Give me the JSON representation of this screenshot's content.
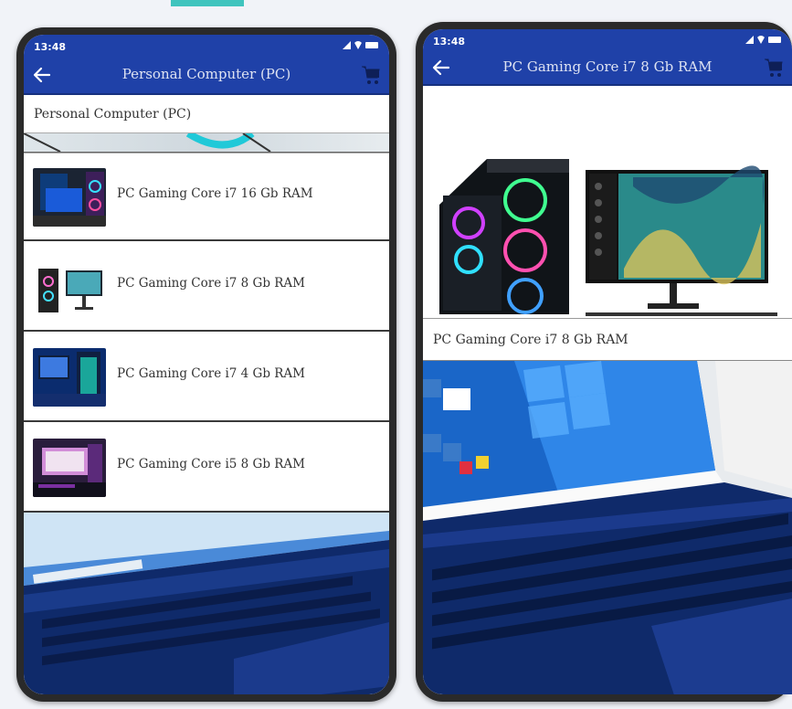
{
  "left_phone": {
    "status_time": "13:48",
    "title": "Personal Computer (PC)",
    "category_label": "Personal Computer (PC)",
    "products": [
      {
        "name": "PC Gaming Core i7 16 Gb RAM"
      },
      {
        "name": "PC Gaming Core i7 8 Gb RAM"
      },
      {
        "name": "PC Gaming Core i7 4 Gb RAM"
      },
      {
        "name": "PC Gaming Core i5 8 Gb RAM"
      }
    ]
  },
  "right_phone": {
    "status_time": "13:48",
    "title": "PC Gaming Core i7 8 Gb RAM",
    "product_name": "PC Gaming Core i7 8 Gb RAM"
  },
  "colors": {
    "appbar": "#1f41a8",
    "accent": "#40c4be",
    "frame": "#2a2a2a"
  },
  "icons": [
    "back-arrow-icon",
    "cart-icon",
    "signal-icon",
    "wifi-icon",
    "battery-icon"
  ]
}
